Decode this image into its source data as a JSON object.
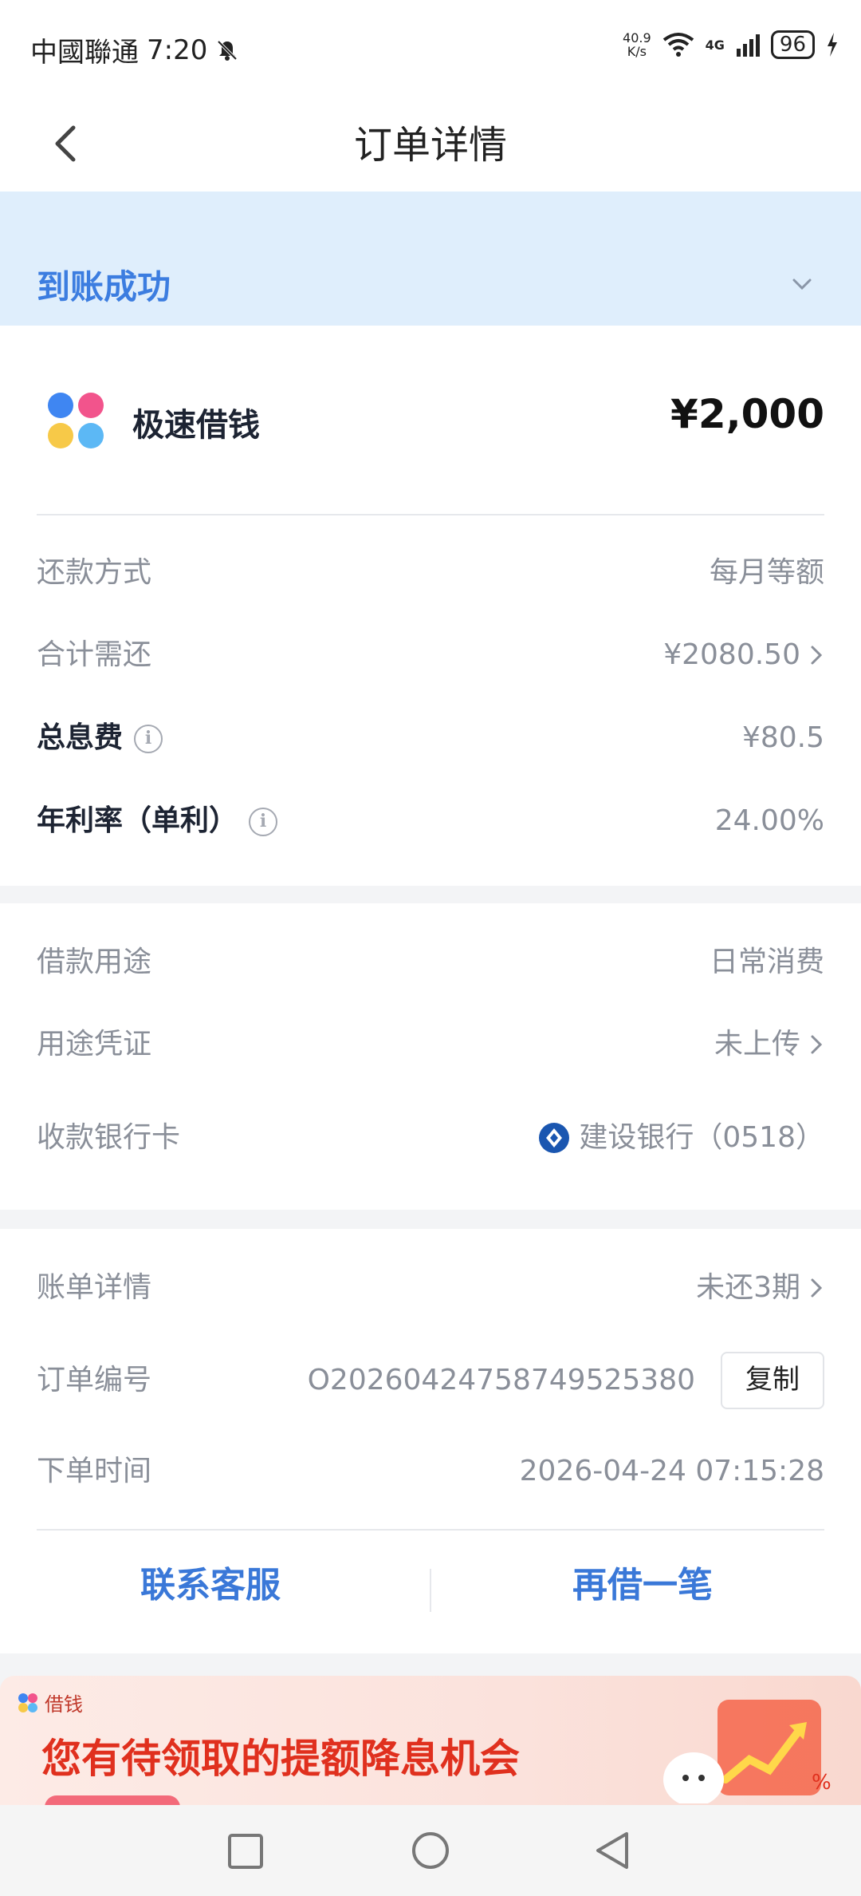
{
  "status_bar": {
    "carrier": "中國聯通",
    "time": "7:20",
    "speed_value": "40.9",
    "speed_unit": "K/s",
    "network": "4G",
    "battery": "96"
  },
  "nav": {
    "title": "订单详情"
  },
  "banner": {
    "status_text": "到账成功"
  },
  "product": {
    "name": "极速借钱",
    "amount": "¥2,000"
  },
  "summary": {
    "repay_method_label": "还款方式",
    "repay_method_value": "每月等额",
    "total_label": "合计需还",
    "total_value": "¥2080.50",
    "interest_label": "总息费",
    "interest_value": "¥80.5",
    "rate_label": "年利率（单利）",
    "rate_value": "24.00%"
  },
  "loan_info": {
    "purpose_label": "借款用途",
    "purpose_value": "日常消费",
    "proof_label": "用途凭证",
    "proof_value": "未上传",
    "card_label": "收款银行卡",
    "card_value": "建设银行（0518）"
  },
  "order_info": {
    "bill_label": "账单详情",
    "bill_value": "未还3期",
    "order_no_label": "订单编号",
    "order_no_value": "O20260424758749525380",
    "copy_label": "复制",
    "time_label": "下单时间",
    "time_value": "2026-04-24 07:15:28"
  },
  "actions": {
    "service": "联系客服",
    "borrow_again": "再借一笔"
  },
  "promo": {
    "tag": "借钱",
    "headline": "您有待领取的提额降息机会"
  },
  "colors": {
    "accent": "#3c7de0",
    "banner_bg": "#dfeefc",
    "promo_red": "#e0301e"
  }
}
